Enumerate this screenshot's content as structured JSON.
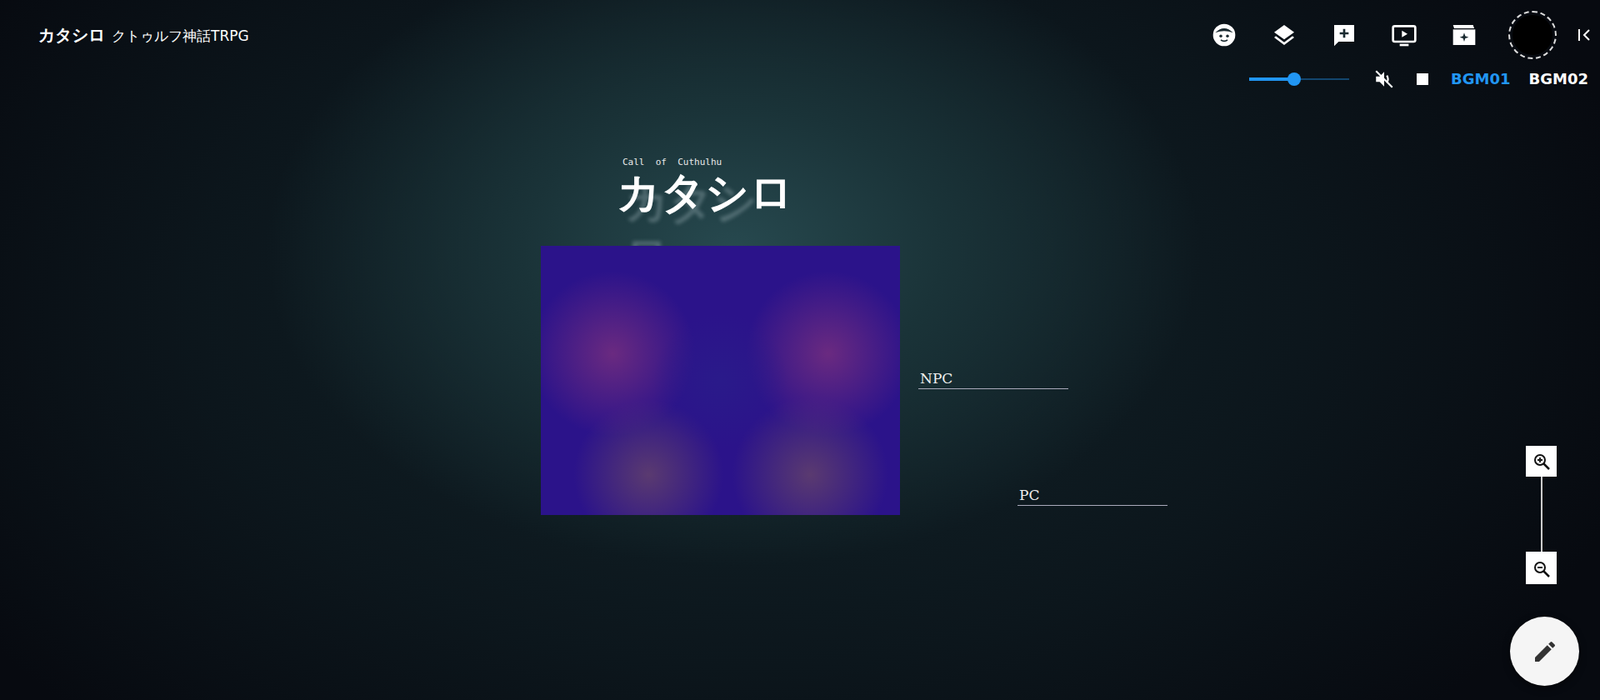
{
  "header": {
    "title": "カタシロ",
    "subtitle": "クトゥルフ神話TRPG"
  },
  "bgm": {
    "volume": {
      "level": 0.45
    },
    "muted": true,
    "tracks": [
      {
        "label": "BGM01",
        "selected": true
      },
      {
        "label": "BGM02",
        "selected": false
      }
    ]
  },
  "board": {
    "kicker": "Call  of  Cuthulhu",
    "title": "カタシロ",
    "labels": [
      {
        "text": "NPC"
      },
      {
        "text": "PC"
      }
    ]
  }
}
